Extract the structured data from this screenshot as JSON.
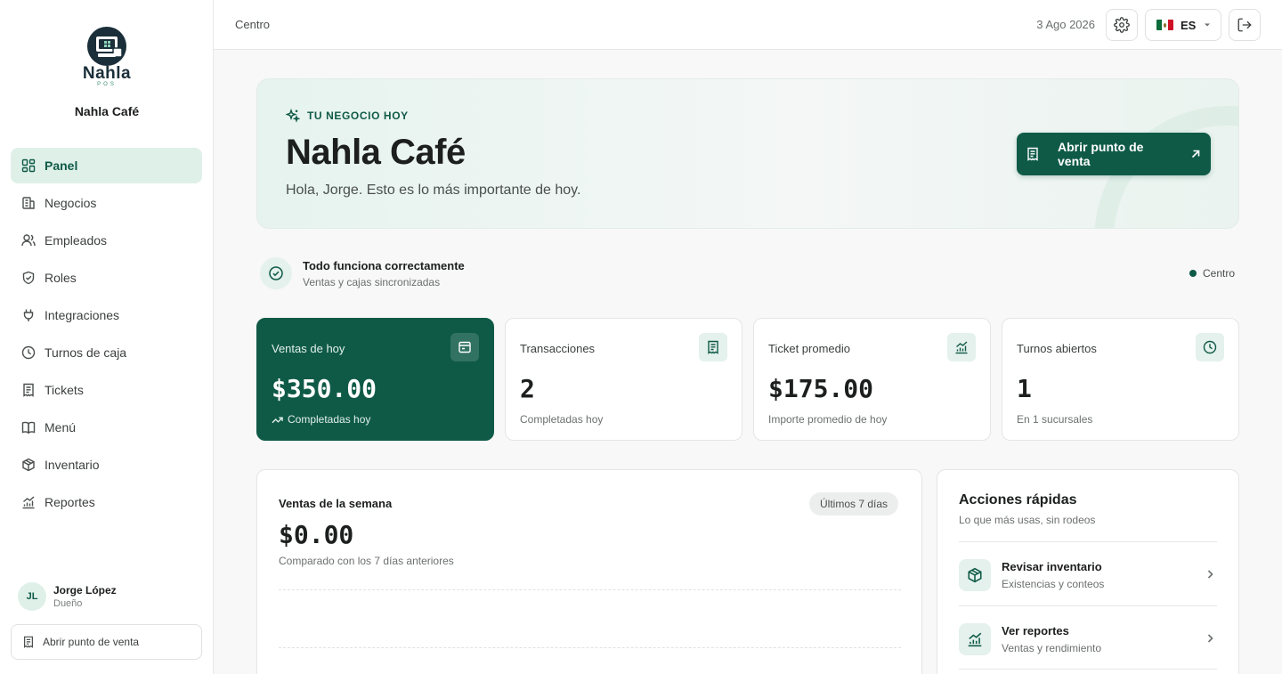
{
  "sidebar": {
    "logo_text": "Nahla",
    "logo_subtext": "POS",
    "business_name": "Nahla Café",
    "items": [
      {
        "label": "Panel",
        "icon": "dashboard-icon",
        "active": true
      },
      {
        "label": "Negocios",
        "icon": "building-icon"
      },
      {
        "label": "Empleados",
        "icon": "users-icon"
      },
      {
        "label": "Roles",
        "icon": "shield-icon"
      },
      {
        "label": "Integraciones",
        "icon": "plug-icon"
      },
      {
        "label": "Turnos de caja",
        "icon": "clock-icon"
      },
      {
        "label": "Tickets",
        "icon": "receipt-icon"
      },
      {
        "label": "Menú",
        "icon": "book-icon"
      },
      {
        "label": "Inventario",
        "icon": "box-icon"
      },
      {
        "label": "Reportes",
        "icon": "chart-icon"
      }
    ],
    "user": {
      "initials": "JL",
      "name": "Jorge López",
      "role": "Dueño"
    },
    "pos_button": "Abrir punto de venta"
  },
  "topbar": {
    "breadcrumb": "Centro",
    "date": "3 Ago 2026",
    "language": "ES"
  },
  "hero": {
    "eyebrow": "TU NEGOCIO HOY",
    "title": "Nahla Café",
    "subtitle": "Hola, Jorge. Esto es lo más importante de hoy.",
    "button": "Abrir punto de venta"
  },
  "status": {
    "title": "Todo funciona correctamente",
    "subtitle": "Ventas y cajas sincronizadas",
    "location": "Centro"
  },
  "kpis": [
    {
      "label": "Ventas de hoy",
      "value": "$350.00",
      "foot": "Completadas hoy",
      "icon": "wallet-icon"
    },
    {
      "label": "Transacciones",
      "value": "2",
      "foot": "Completadas hoy",
      "icon": "receipt-icon"
    },
    {
      "label": "Ticket promedio",
      "value": "$175.00",
      "foot": "Importe promedio de hoy",
      "icon": "chart-icon"
    },
    {
      "label": "Turnos abiertos",
      "value": "1",
      "foot": "En 1 sucursales",
      "icon": "clock-icon"
    }
  ],
  "week": {
    "title": "Ventas de la semana",
    "value": "$0.00",
    "subtitle": "Comparado con los 7 días anteriores",
    "range": "Últimos 7 días"
  },
  "quick": {
    "title": "Acciones rápidas",
    "subtitle": "Lo que más usas, sin rodeos",
    "items": [
      {
        "title": "Revisar inventario",
        "subtitle": "Existencias y conteos",
        "icon": "box-icon"
      },
      {
        "title": "Ver reportes",
        "subtitle": "Ventas y rendimiento",
        "icon": "chart-icon"
      }
    ]
  },
  "colors": {
    "primary": "#0f5a47",
    "primary_tint": "#dff0e9",
    "background": "#f7f8f7"
  }
}
